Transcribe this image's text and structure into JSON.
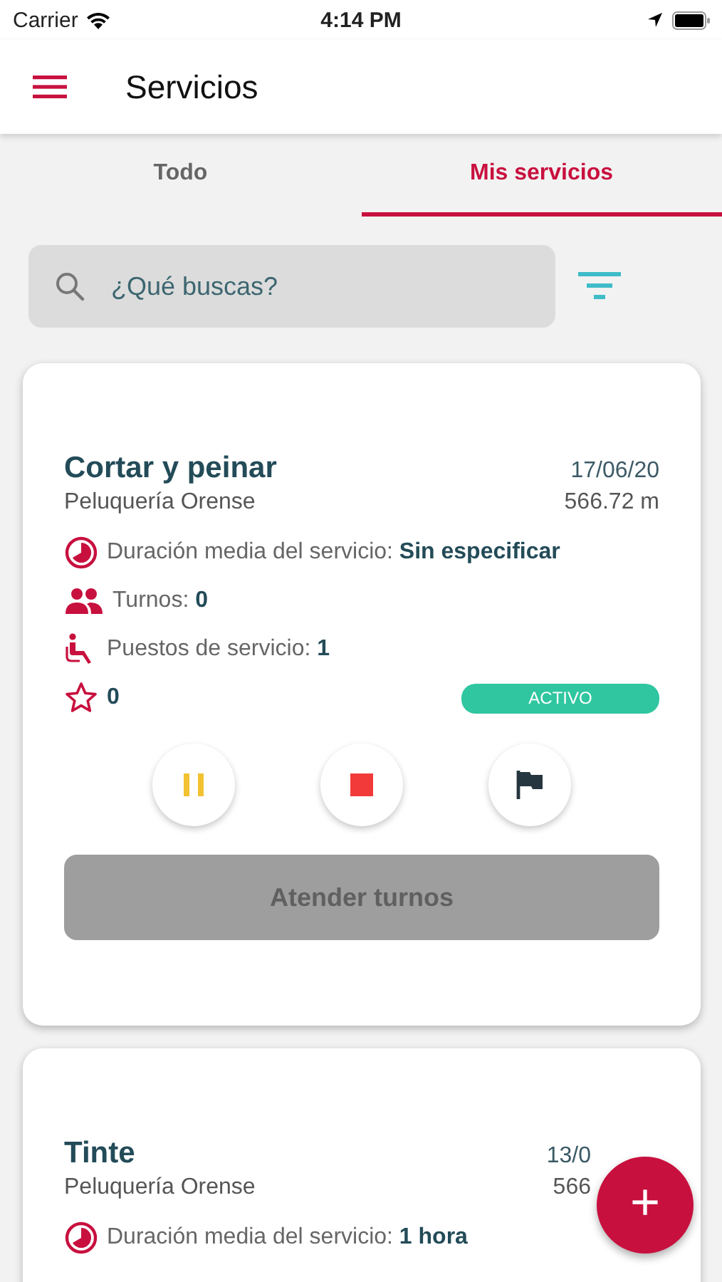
{
  "status_bar": {
    "carrier": "Carrier",
    "time": "4:14 PM"
  },
  "header": {
    "title": "Servicios"
  },
  "tabs": [
    {
      "label": "Todo",
      "selected": false
    },
    {
      "label": "Mis servicios",
      "selected": true
    }
  ],
  "search": {
    "placeholder": "¿Qué buscas?"
  },
  "services": [
    {
      "title": "Cortar y peinar",
      "date": "17/06/20",
      "place": "Peluquería Orense",
      "distance": "566.72 m",
      "info": [
        {
          "kind": "duration",
          "text": "Duración media del servicio: **Sin especificar**"
        },
        {
          "kind": "turns",
          "text": "Turnos: **0**"
        },
        {
          "kind": "seats",
          "text": "Puestos de servicio: **1**"
        }
      ],
      "rating": "0",
      "status": "ACTIVO",
      "actions": [
        {
          "kind": "pause"
        },
        {
          "kind": "stop"
        },
        {
          "kind": "flag"
        }
      ],
      "attend": {
        "label": "Atender turnos",
        "disabled": true
      }
    },
    {
      "title": "Tinte",
      "date": "13/0",
      "place": "Peluquería Orense",
      "distance": "566",
      "info": [
        {
          "kind": "duration",
          "text": "Duración media del servicio: **1 hora**"
        }
      ]
    }
  ],
  "fab": {
    "label": "+"
  }
}
